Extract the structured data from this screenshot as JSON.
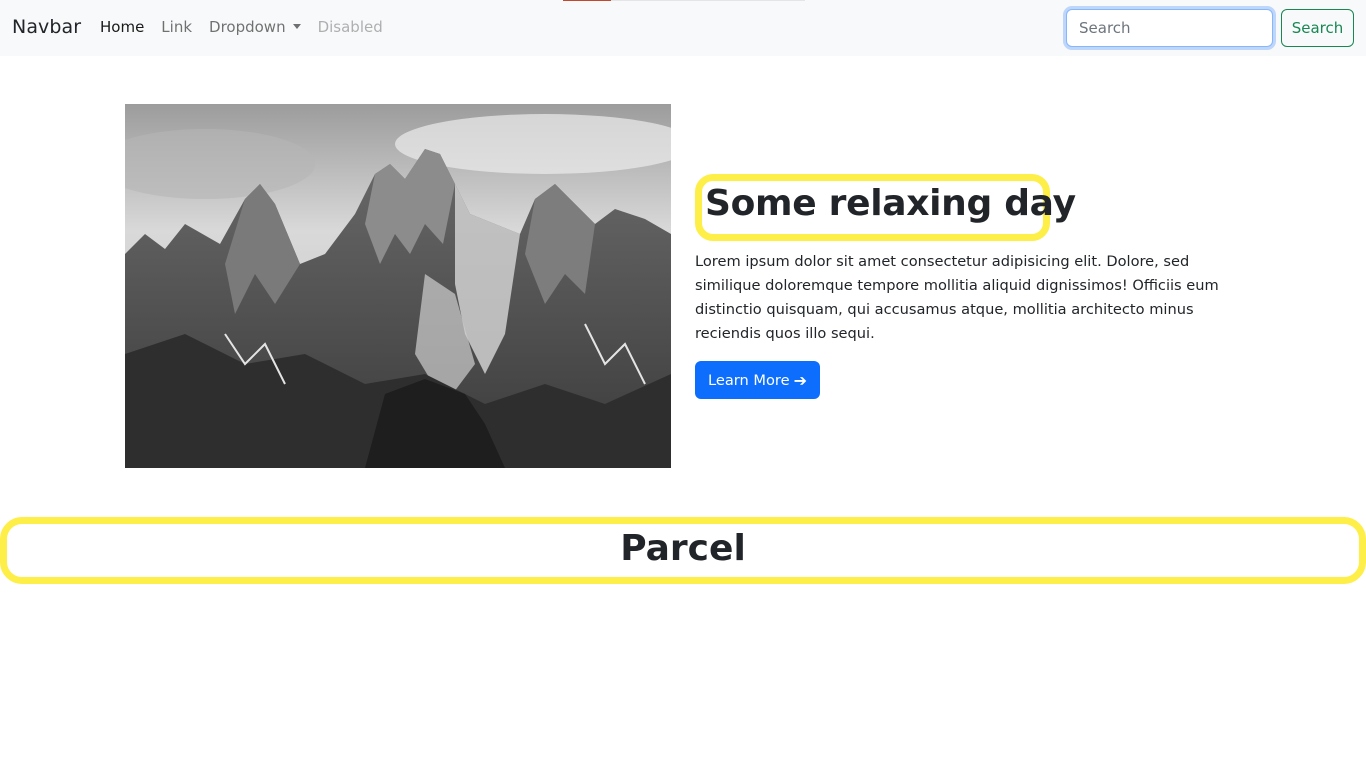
{
  "navbar": {
    "brand": "Navbar",
    "links": [
      {
        "label": "Home",
        "state": "active"
      },
      {
        "label": "Link",
        "state": "normal"
      },
      {
        "label": "Dropdown",
        "state": "dropdown"
      },
      {
        "label": "Disabled",
        "state": "disabled"
      }
    ],
    "search": {
      "placeholder": "Search",
      "value": "",
      "button_label": "Search"
    },
    "page_load_progress": 0.2
  },
  "hero": {
    "image": {
      "alt": "Black and white photo of jagged mountain peaks"
    },
    "title": "Some relaxing day",
    "description": "Lorem ipsum dolor sit amet consectetur adipisicing elit. Dolore, sed similique doloremque tempore mollitia aliquid dignissimos! Officiis eum distinctio quisquam, qui accusamus atque, mollitia architecto minus reciendis quos illo sequi.",
    "button": {
      "label": "Learn More",
      "icon": "arrow-right-icon"
    }
  },
  "section": {
    "title": "Parcel"
  },
  "colors": {
    "navbar_bg": "#f8f9fa",
    "primary": "#0d6efd",
    "success": "#198754",
    "highlight": "#fdee48",
    "progress": "#c0492e"
  }
}
